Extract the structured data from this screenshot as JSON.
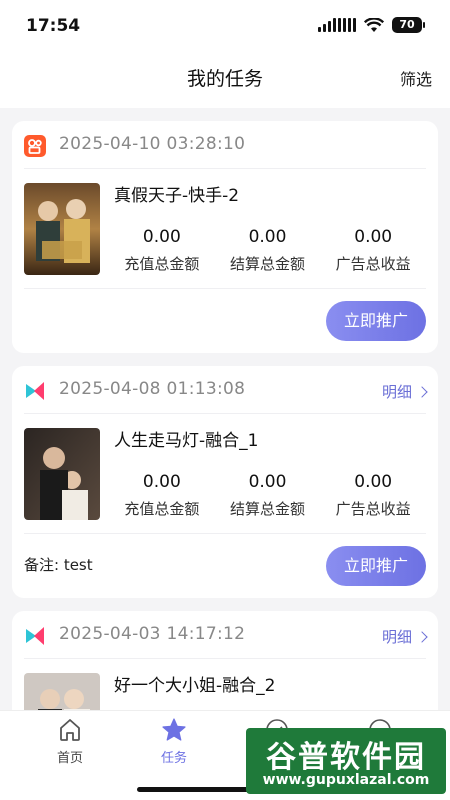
{
  "status": {
    "time": "17:54",
    "battery": "70"
  },
  "nav": {
    "title": "我的任务",
    "filter": "筛选"
  },
  "labels": {
    "recharge": "充值总金额",
    "settle": "结算总金额",
    "ad": "广告总收益",
    "promote": "立即推广",
    "detail": "明细"
  },
  "tasks": [
    {
      "platform": "kuaishou-icon",
      "time": "2025-04-10 03:28:10",
      "title": "真假天子-快手-2",
      "recharge": "0.00",
      "settle": "0.00",
      "ad": "0.00",
      "has_detail": false,
      "note": ""
    },
    {
      "platform": "ronghe-icon",
      "time": "2025-04-08 01:13:08",
      "title": "人生走马灯-融合_1",
      "recharge": "0.00",
      "settle": "0.00",
      "ad": "0.00",
      "has_detail": true,
      "note": "备注: test"
    },
    {
      "platform": "ronghe-icon",
      "time": "2025-04-03 14:17:12",
      "title": "好一个大小姐-融合_2",
      "has_detail": true
    }
  ],
  "tabs": [
    {
      "label": "首页",
      "icon": "home-icon",
      "active": false
    },
    {
      "label": "任务",
      "icon": "star-icon",
      "active": true
    }
  ],
  "watermark": {
    "text": "谷普软件园",
    "url": "www.gupuxlazal.com"
  },
  "colors": {
    "accent": "#6d71e3",
    "kuaishou": "#ff5a2c"
  }
}
